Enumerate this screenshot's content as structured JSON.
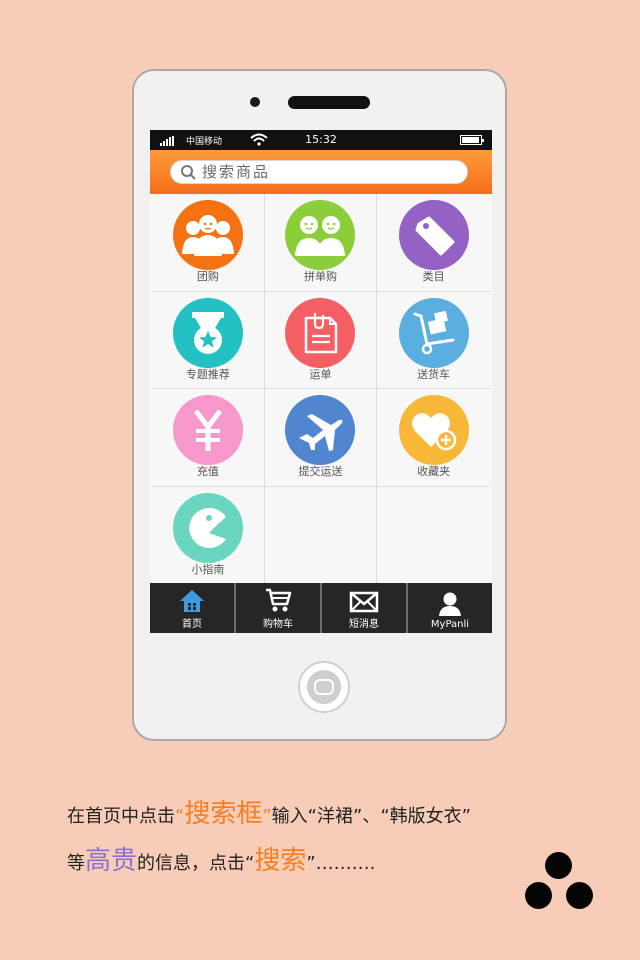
{
  "status": {
    "carrier": "中国移动",
    "time": "15:32"
  },
  "search": {
    "placeholder": "搜索商品"
  },
  "grid": [
    {
      "label": "团购",
      "icon": "group-buy-icon",
      "color": "#f57212"
    },
    {
      "label": "拼单购",
      "icon": "shared-order-icon",
      "color": "#8ccd3a"
    },
    {
      "label": "类目",
      "icon": "tag-icon",
      "color": "#9461c5"
    },
    {
      "label": "专题推荐",
      "icon": "medal-icon",
      "color": "#24c1c3"
    },
    {
      "label": "运单",
      "icon": "clipboard-icon",
      "color": "#f45f63"
    },
    {
      "label": "送货车",
      "icon": "hand-truck-icon",
      "color": "#5aafe0"
    },
    {
      "label": "充值",
      "icon": "yen-icon",
      "color": "#f698cc"
    },
    {
      "label": "提交运送",
      "icon": "airplane-icon",
      "color": "#4f86cf"
    },
    {
      "label": "收藏夹",
      "icon": "heart-add-icon",
      "color": "#f7b83a"
    },
    {
      "label": "小指南",
      "icon": "pacman-icon",
      "color": "#6ad6c0"
    }
  ],
  "tabs": [
    {
      "label": "首页",
      "icon": "home-icon",
      "color": "#3f9ce4"
    },
    {
      "label": "购物车",
      "icon": "cart-icon",
      "color": "#ffffff"
    },
    {
      "label": "短消息",
      "icon": "mail-icon",
      "color": "#ffffff"
    },
    {
      "label": "MyPanli",
      "icon": "user-icon",
      "color": "#ffffff"
    }
  ],
  "caption": {
    "l1_a": "在首页中点击",
    "l1_q1": "“",
    "l1_hl": "搜索框",
    "l1_q2": "”",
    "l1_b": "输入“洋裙”、“韩版女衣”",
    "l2_a": "等",
    "l2_hl": "高贵",
    "l2_b": "的信息，点击“",
    "l2_hl2": "搜索",
    "l2_c": "”………."
  }
}
